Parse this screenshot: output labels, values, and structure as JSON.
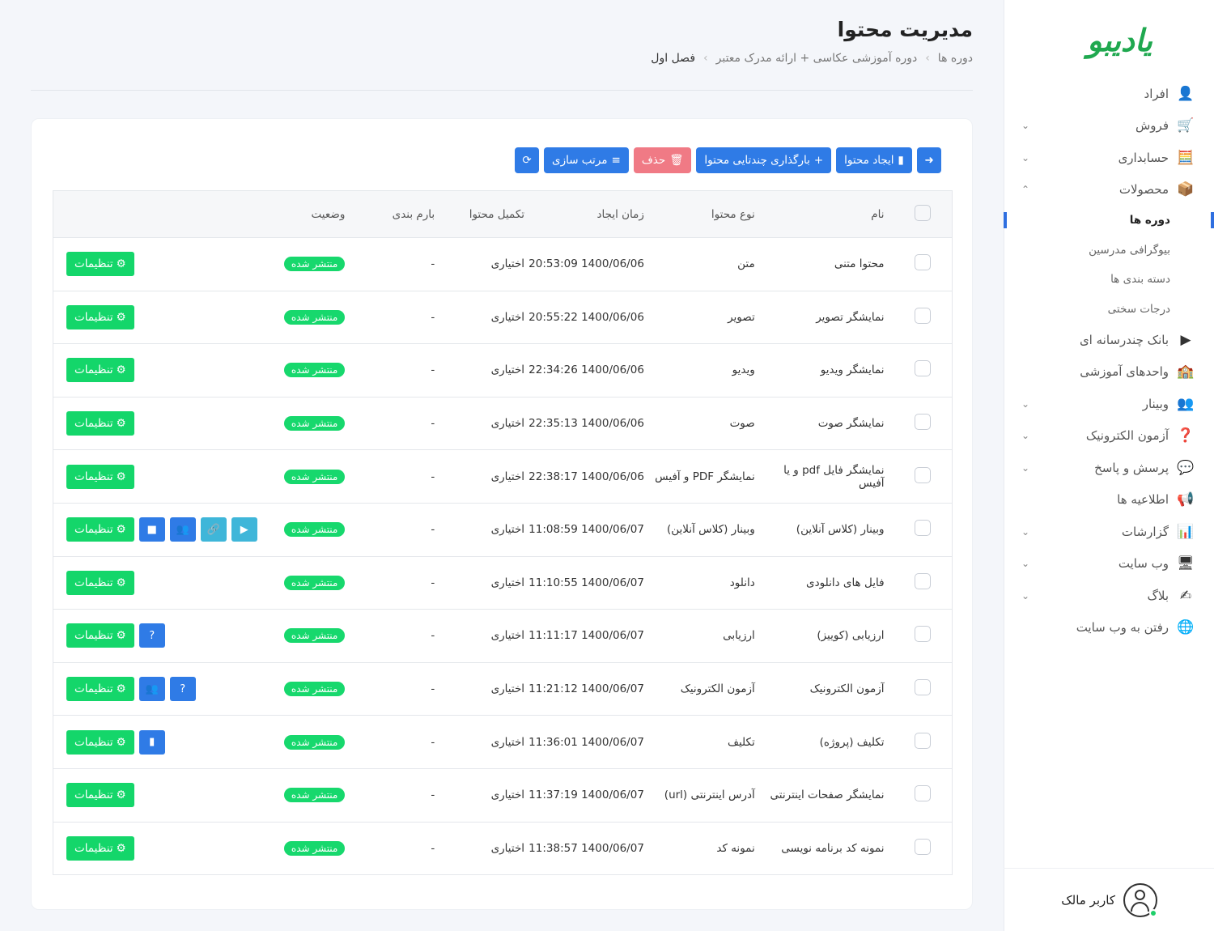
{
  "sidebar": {
    "logo": "یادیبو",
    "menu": [
      {
        "label": "افراد",
        "icon": "person-icon",
        "glyph": "👤",
        "chevron": ""
      },
      {
        "label": "فروش",
        "icon": "cart-icon",
        "glyph": "🛒",
        "chevron": "⌄"
      },
      {
        "label": "حسابداری",
        "icon": "calculator-icon",
        "glyph": "🧮",
        "chevron": "⌄"
      },
      {
        "label": "محصولات",
        "icon": "box-icon",
        "glyph": "📦",
        "chevron": "⌃"
      }
    ],
    "submenu": [
      {
        "label": "دوره ها",
        "active": true
      },
      {
        "label": "بیوگرافی مدرسین",
        "active": false
      },
      {
        "label": "دسته بندی ها",
        "active": false
      },
      {
        "label": "درجات سختی",
        "active": false
      }
    ],
    "menu2": [
      {
        "label": "بانک چندرسانه ای",
        "icon": "media-icon",
        "glyph": "▶",
        "chevron": ""
      },
      {
        "label": "واحدهای آموزشی",
        "icon": "school-icon",
        "glyph": "🏫",
        "chevron": ""
      },
      {
        "label": "وبینار",
        "icon": "webinar-icon",
        "glyph": "👥",
        "chevron": "⌄"
      },
      {
        "label": "آزمون الکترونیک",
        "icon": "question-icon",
        "glyph": "❓",
        "chevron": "⌄"
      },
      {
        "label": "پرسش و پاسخ",
        "icon": "chat-icon",
        "glyph": "💬",
        "chevron": "⌄"
      },
      {
        "label": "اطلاعیه ها",
        "icon": "megaphone-icon",
        "glyph": "📢",
        "chevron": ""
      },
      {
        "label": "گزارشات",
        "icon": "chart-icon",
        "glyph": "📊",
        "chevron": "⌄"
      },
      {
        "label": "وب سایت",
        "icon": "website-icon",
        "glyph": "🖥",
        "chevron": "⌄"
      },
      {
        "label": "بلاگ",
        "icon": "blog-icon",
        "glyph": "✍",
        "chevron": "⌄"
      },
      {
        "label": "رفتن به وب سایت",
        "icon": "globe-icon",
        "glyph": "🌐",
        "chevron": ""
      }
    ],
    "user": "کاربر مالک"
  },
  "header": {
    "title": "مدیریت محتوا",
    "breadcrumb": [
      "دوره ها",
      "دوره آموزشی عکاسی + ارائه مدرک معتبر",
      "فصل اول"
    ]
  },
  "toolbar": {
    "create": "ایجاد محتوا",
    "bulk_upload": "بارگذاری چندتایی محتوا",
    "delete": "حذف",
    "sort": "مرتب سازی"
  },
  "table": {
    "headers": {
      "name": "نام",
      "type": "نوع محتوا",
      "created": "زمان ایجاد",
      "completion": "تکمیل محتوا",
      "grading": "بارم بندی",
      "status": "وضعیت"
    },
    "settings_label": "تنظیمات",
    "rows": [
      {
        "name": "محتوا متنی",
        "type": "متن",
        "created": "20:53:09 1400/06/06",
        "completion": "اختیاری",
        "grading": "-",
        "status": "منتشر شده",
        "extra": []
      },
      {
        "name": "نمایشگر تصویر",
        "type": "تصویر",
        "created": "20:55:22 1400/06/06",
        "completion": "اختیاری",
        "grading": "-",
        "status": "منتشر شده",
        "extra": []
      },
      {
        "name": "نمایشگر ویدیو",
        "type": "ویدیو",
        "created": "22:34:26 1400/06/06",
        "completion": "اختیاری",
        "grading": "-",
        "status": "منتشر شده",
        "extra": []
      },
      {
        "name": "نمایشگر صوت",
        "type": "صوت",
        "created": "22:35:13 1400/06/06",
        "completion": "اختیاری",
        "grading": "-",
        "status": "منتشر شده",
        "extra": []
      },
      {
        "name": "نمایشگر فایل pdf و یا آفیس",
        "type": "نمایشگر PDF و آفیس",
        "created": "22:38:17 1400/06/06",
        "completion": "اختیاری",
        "grading": "-",
        "status": "منتشر شده",
        "extra": []
      },
      {
        "name": "وبینار (کلاس آنلاین)",
        "type": "وبینار (کلاس آنلاین)",
        "created": "11:08:59 1400/06/07",
        "completion": "اختیاری",
        "grading": "-",
        "status": "منتشر شده",
        "extra": [
          {
            "icon": "video-camera-icon",
            "glyph": "■",
            "color": "blue"
          },
          {
            "icon": "users-icon",
            "glyph": "👥",
            "color": "blue"
          },
          {
            "icon": "link-icon",
            "glyph": "🔗",
            "color": "teal"
          },
          {
            "icon": "play-icon",
            "glyph": "▶",
            "color": "teal"
          }
        ]
      },
      {
        "name": "فایل های دانلودی",
        "type": "دانلود",
        "created": "11:10:55 1400/06/07",
        "completion": "اختیاری",
        "grading": "-",
        "status": "منتشر شده",
        "extra": []
      },
      {
        "name": "ارزیابی (کوییز)",
        "type": "ارزیابی",
        "created": "11:11:17 1400/06/07",
        "completion": "اختیاری",
        "grading": "-",
        "status": "منتشر شده",
        "extra": [
          {
            "icon": "question-icon",
            "glyph": "?",
            "color": "blue"
          }
        ]
      },
      {
        "name": "آزمون الکترونیک",
        "type": "آزمون الکترونیک",
        "created": "11:21:12 1400/06/07",
        "completion": "اختیاری",
        "grading": "-",
        "status": "منتشر شده",
        "extra": [
          {
            "icon": "users-icon",
            "glyph": "👥",
            "color": "blue"
          },
          {
            "icon": "question-icon",
            "glyph": "?",
            "color": "blue"
          }
        ]
      },
      {
        "name": "تکلیف (پروژه)",
        "type": "تکلیف",
        "created": "11:36:01 1400/06/07",
        "completion": "اختیاری",
        "grading": "-",
        "status": "منتشر شده",
        "extra": [
          {
            "icon": "file-icon",
            "glyph": "▮",
            "color": "blue"
          }
        ]
      },
      {
        "name": "نمایشگر صفحات اینترنتی",
        "type": "آدرس اینترنتی (url)",
        "created": "11:37:19 1400/06/07",
        "completion": "اختیاری",
        "grading": "-",
        "status": "منتشر شده",
        "extra": []
      },
      {
        "name": "نمونه کد برنامه نویسی",
        "type": "نمونه کد",
        "created": "11:38:57 1400/06/07",
        "completion": "اختیاری",
        "grading": "-",
        "status": "منتشر شده",
        "extra": []
      }
    ]
  }
}
